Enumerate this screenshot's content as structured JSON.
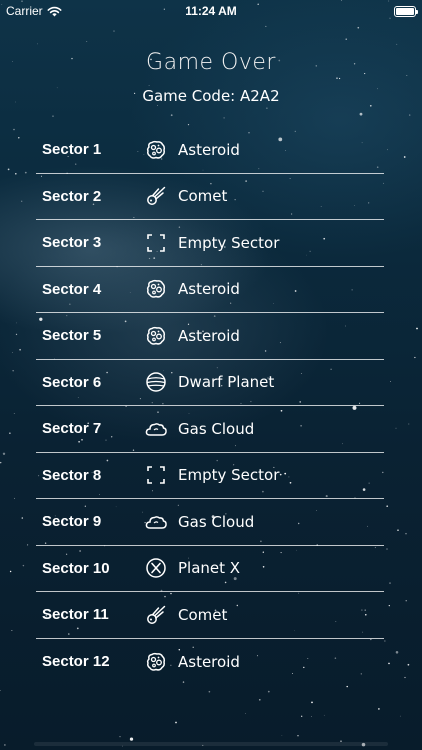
{
  "status_bar": {
    "carrier": "Carrier",
    "time": "11:24 AM"
  },
  "header": {
    "title": "Game Over",
    "game_code": "Game Code: A2A2"
  },
  "sectors": [
    {
      "label": "Sector 1",
      "object": "Asteroid",
      "icon": "asteroid-icon"
    },
    {
      "label": "Sector 2",
      "object": "Comet",
      "icon": "comet-icon"
    },
    {
      "label": "Sector 3",
      "object": "Empty Sector",
      "icon": "empty-sector-icon"
    },
    {
      "label": "Sector 4",
      "object": "Asteroid",
      "icon": "asteroid-icon"
    },
    {
      "label": "Sector 5",
      "object": "Asteroid",
      "icon": "asteroid-icon"
    },
    {
      "label": "Sector 6",
      "object": "Dwarf Planet",
      "icon": "dwarf-planet-icon"
    },
    {
      "label": "Sector 7",
      "object": "Gas Cloud",
      "icon": "gas-cloud-icon"
    },
    {
      "label": "Sector 8",
      "object": "Empty Sector",
      "icon": "empty-sector-icon"
    },
    {
      "label": "Sector 9",
      "object": "Gas Cloud",
      "icon": "gas-cloud-icon"
    },
    {
      "label": "Sector 10",
      "object": "Planet X",
      "icon": "planet-x-icon"
    },
    {
      "label": "Sector 11",
      "object": "Comet",
      "icon": "comet-icon"
    },
    {
      "label": "Sector 12",
      "object": "Asteroid",
      "icon": "asteroid-icon"
    }
  ]
}
